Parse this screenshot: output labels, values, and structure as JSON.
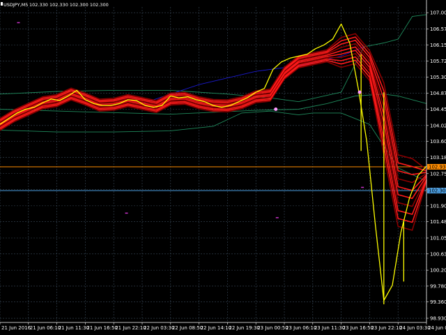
{
  "window": {
    "title": "USDJPY,M5",
    "ohlc": "102.330 102.330 102.300 102.300"
  },
  "colors": {
    "background": "#000000",
    "grid": "#3a4a5a",
    "price_line": "#ffff00",
    "ribbon": "#ff1a1a",
    "ribbon_dark": "#8b0000",
    "envelope": "#1f8a5c",
    "trend_line": "#1a1acc",
    "orange_level": "#ff8c00",
    "blue_level": "#4a9bdc",
    "axis_text": "#ffffff",
    "markers": "#cc33cc",
    "price_tag": "#ffffff"
  },
  "chart_data": {
    "type": "line",
    "symbol": "USDJPY",
    "timeframe": "M5",
    "y_ticks": [
      107.0,
      106.57,
      106.15,
      105.72,
      105.3,
      104.87,
      104.45,
      104.02,
      103.6,
      103.18,
      102.75,
      102.33,
      101.9,
      101.48,
      101.05,
      100.63,
      100.2,
      99.78,
      99.36,
      98.93
    ],
    "y_tick_labels": [
      "107.000",
      "106.570",
      "106.150",
      "105.720",
      "105.300",
      "104.870",
      "104.450",
      "104.020",
      "103.600",
      "103.180",
      "102.750",
      "102.330",
      "101.900",
      "101.480",
      "101.050",
      "100.630",
      "100.200",
      "99.780",
      "99.360",
      "98.930"
    ],
    "ylim": [
      98.82,
      107.15
    ],
    "x_tick_labels": [
      "21 Jun 2016",
      "21 Jun 06:10",
      "21 Jun 11:30",
      "21 Jun 16:50",
      "21 Jun 22:10",
      "22 Jun 03:30",
      "22 Jun 08:50",
      "22 Jun 14:10",
      "22 Jun 19:30",
      "23 Jun 00:50",
      "23 Jun 06:10",
      "23 Jun 11:30",
      "23 Jun 16:50",
      "23 Jun 22:10",
      "24 Jun 03:30",
      "24 Jun 08:50"
    ],
    "price_tags": [
      {
        "value": 102.93,
        "label": "102.930",
        "color": "#ff8c00"
      },
      {
        "value": 102.3,
        "label": "102.300",
        "color": "#4a9bdc"
      }
    ],
    "grid": true,
    "series": [
      {
        "name": "close",
        "x": [
          0,
          0.3,
          0.6,
          0.9,
          1.2,
          1.5,
          1.8,
          2.1,
          2.4,
          2.7,
          3,
          3.3,
          3.6,
          3.9,
          4.2,
          4.5,
          4.8,
          5.1,
          5.4,
          5.7,
          6,
          6.3,
          6.6,
          6.9,
          7.2,
          7.5,
          7.8,
          8.1,
          8.4,
          8.7,
          9,
          9.3,
          9.6,
          9.9,
          10.2,
          10.5,
          10.8,
          11.1,
          11.4,
          11.7,
          12,
          12.3,
          12.6,
          12.9,
          13.2,
          13.5,
          13.8,
          14.1,
          14.4,
          14.7,
          15
        ],
        "values": [
          104.05,
          104.2,
          104.35,
          104.45,
          104.5,
          104.62,
          104.72,
          104.68,
          104.8,
          104.95,
          104.7,
          104.6,
          104.55,
          104.55,
          104.6,
          104.7,
          104.68,
          104.55,
          104.5,
          104.55,
          104.8,
          104.75,
          104.78,
          104.7,
          104.65,
          104.55,
          104.5,
          104.55,
          104.65,
          104.75,
          104.9,
          105.0,
          105.5,
          105.7,
          105.8,
          105.85,
          105.9,
          106.05,
          106.15,
          106.3,
          106.7,
          106.2,
          105.0,
          103.6,
          101.4,
          99.4,
          99.8,
          101.2,
          102.1,
          102.7,
          102.95
        ]
      },
      {
        "name": "ribbon",
        "x": [
          0,
          0.5,
          1,
          1.5,
          2,
          2.5,
          3,
          3.5,
          4,
          4.5,
          5,
          5.5,
          6,
          6.5,
          7,
          7.5,
          8,
          8.5,
          9,
          9.5,
          10,
          10.5,
          11,
          11.5,
          12,
          12.5,
          13,
          13.5,
          14,
          14.5,
          15
        ],
        "values": [
          104.05,
          104.28,
          104.45,
          104.62,
          104.68,
          104.85,
          104.72,
          104.56,
          104.58,
          104.68,
          104.6,
          104.52,
          104.72,
          104.74,
          104.62,
          104.55,
          104.54,
          104.62,
          104.78,
          104.82,
          105.4,
          105.7,
          105.78,
          105.86,
          105.95,
          106.05,
          105.6,
          104.2,
          102.3,
          102.2,
          102.7
        ]
      },
      {
        "name": "envelope_upper",
        "x": [
          0,
          2,
          4,
          6,
          8,
          9.5,
          10.5,
          12,
          12.8,
          13.5,
          14,
          14.5,
          15
        ],
        "values": [
          104.85,
          104.92,
          104.95,
          104.95,
          104.85,
          104.75,
          104.65,
          104.9,
          106.1,
          106.2,
          106.3,
          106.9,
          106.95
        ]
      },
      {
        "name": "envelope_lower",
        "x": [
          0,
          2,
          4,
          6,
          7.5,
          8.5,
          9.5,
          10.5,
          11,
          12,
          13,
          14,
          15
        ],
        "values": [
          103.9,
          103.85,
          103.85,
          103.88,
          104.0,
          104.35,
          104.4,
          104.3,
          104.35,
          104.35,
          104.05,
          102.9,
          102.55
        ]
      },
      {
        "name": "envelope_mid",
        "x": [
          0,
          3,
          6,
          9,
          10.5,
          11.5,
          12.5,
          13.5,
          14,
          15
        ],
        "values": [
          104.45,
          104.38,
          104.32,
          104.42,
          104.45,
          104.6,
          104.8,
          104.85,
          104.8,
          104.6
        ]
      },
      {
        "name": "trend",
        "x": [
          5,
          7,
          9,
          10.5,
          12,
          12.8
        ],
        "values": [
          104.6,
          105.1,
          105.45,
          105.6,
          105.85,
          106.1
        ]
      }
    ]
  }
}
